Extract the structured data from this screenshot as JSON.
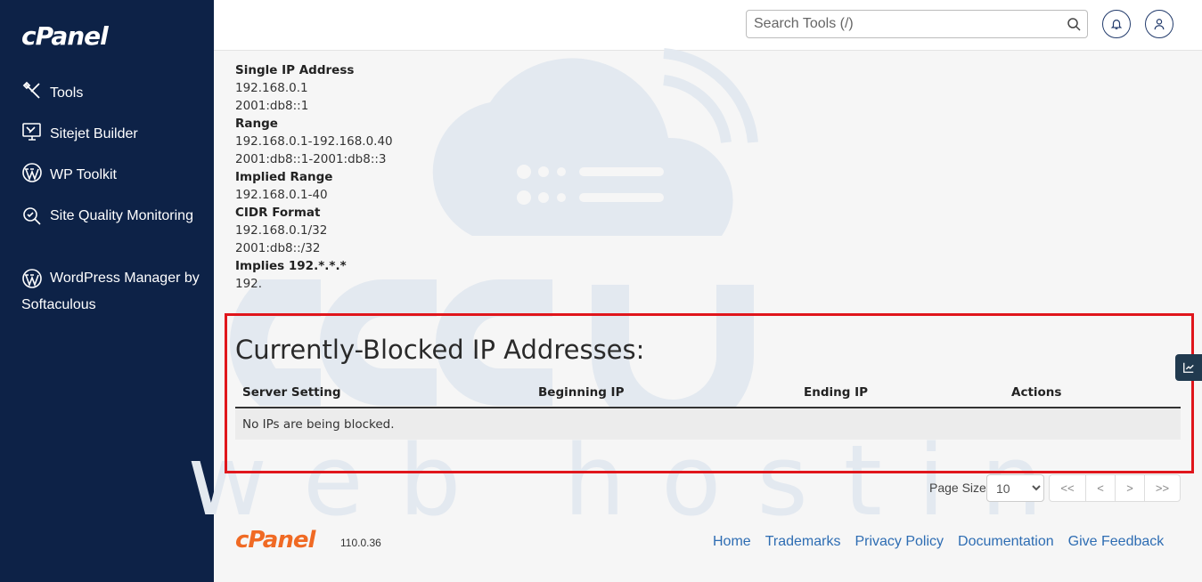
{
  "sidebar": {
    "logo": "cPanel",
    "items": [
      {
        "label": "Tools"
      },
      {
        "label": "Sitejet Builder"
      },
      {
        "label": "WP Toolkit"
      },
      {
        "label": "Site Quality Monitoring"
      },
      {
        "label": "WordPress Manager by Softaculous"
      }
    ]
  },
  "header": {
    "search_placeholder": "Search Tools (/)"
  },
  "examples": [
    {
      "text": "Single IP Address",
      "bold": true
    },
    {
      "text": "192.168.0.1",
      "bold": false
    },
    {
      "text": "2001:db8::1",
      "bold": false
    },
    {
      "text": "Range",
      "bold": true
    },
    {
      "text": "192.168.0.1-192.168.0.40",
      "bold": false
    },
    {
      "text": "2001:db8::1-2001:db8::3",
      "bold": false
    },
    {
      "text": "Implied Range",
      "bold": true
    },
    {
      "text": "192.168.0.1-40",
      "bold": false
    },
    {
      "text": "CIDR Format",
      "bold": true
    },
    {
      "text": "192.168.0.1/32",
      "bold": false
    },
    {
      "text": "2001:db8::/32",
      "bold": false
    },
    {
      "text": "Implies 192.*.*.*",
      "bold": true
    },
    {
      "text": "192.",
      "bold": false
    }
  ],
  "blocked": {
    "title": "Currently-Blocked IP Addresses:",
    "columns": [
      "Server Setting",
      "Beginning IP",
      "Ending IP",
      "Actions"
    ],
    "empty_message": "No IPs are being blocked."
  },
  "pagination": {
    "page_size_label": "Page Size",
    "page_size_value": "10",
    "first": "<<",
    "prev": "<",
    "next": ">",
    "last": ">>"
  },
  "footer": {
    "logo": "cPanel",
    "version": "110.0.36",
    "links": [
      "Home",
      "Trademarks",
      "Privacy Policy",
      "Documentation",
      "Give Feedback"
    ]
  },
  "colors": {
    "sidebar_bg": "#0d2247",
    "highlight": "#e0161c",
    "link": "#2e6db3",
    "brand_orange": "#f06a24"
  }
}
